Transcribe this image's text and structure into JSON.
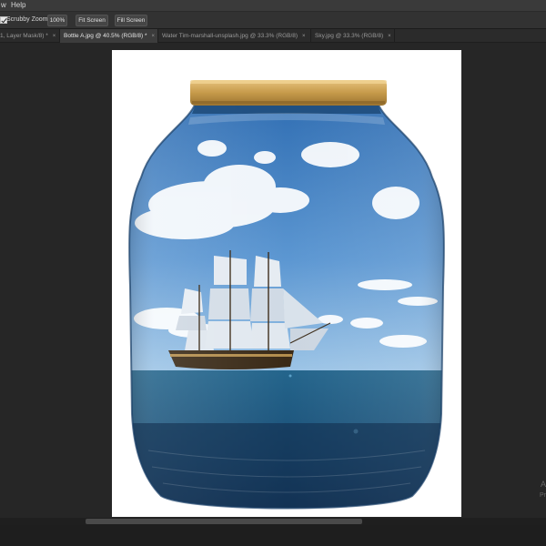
{
  "menu": {
    "items": [
      "w",
      "Help"
    ]
  },
  "options": {
    "scrubby_zoom_label": "Scrubby Zoom",
    "zoom_100_label": "100%",
    "fit_screen_label": "Fit Screen",
    "fill_screen_label": "Fill Screen"
  },
  "tabs": [
    {
      "label": "1, Layer Mask/8) *",
      "close": "×",
      "active": false
    },
    {
      "label": "Bottle A.jpg @ 40.5% (RGB/8) *",
      "close": "×",
      "active": true
    },
    {
      "label": "Water Tim-marshall-unsplash.jpg @ 33.3% (RGB/8)",
      "close": "×",
      "active": false
    },
    {
      "label": "Sky.jpg @ 33.3% (RGB/8)",
      "close": "×",
      "active": false
    }
  ],
  "watermark": {
    "line1": "A",
    "line2": "Pr"
  },
  "colors": {
    "lid": "#c69a4a",
    "sky_top": "#3f7fc4",
    "sea": "#1e5a80",
    "bottle_dark": "#1a3f66"
  }
}
